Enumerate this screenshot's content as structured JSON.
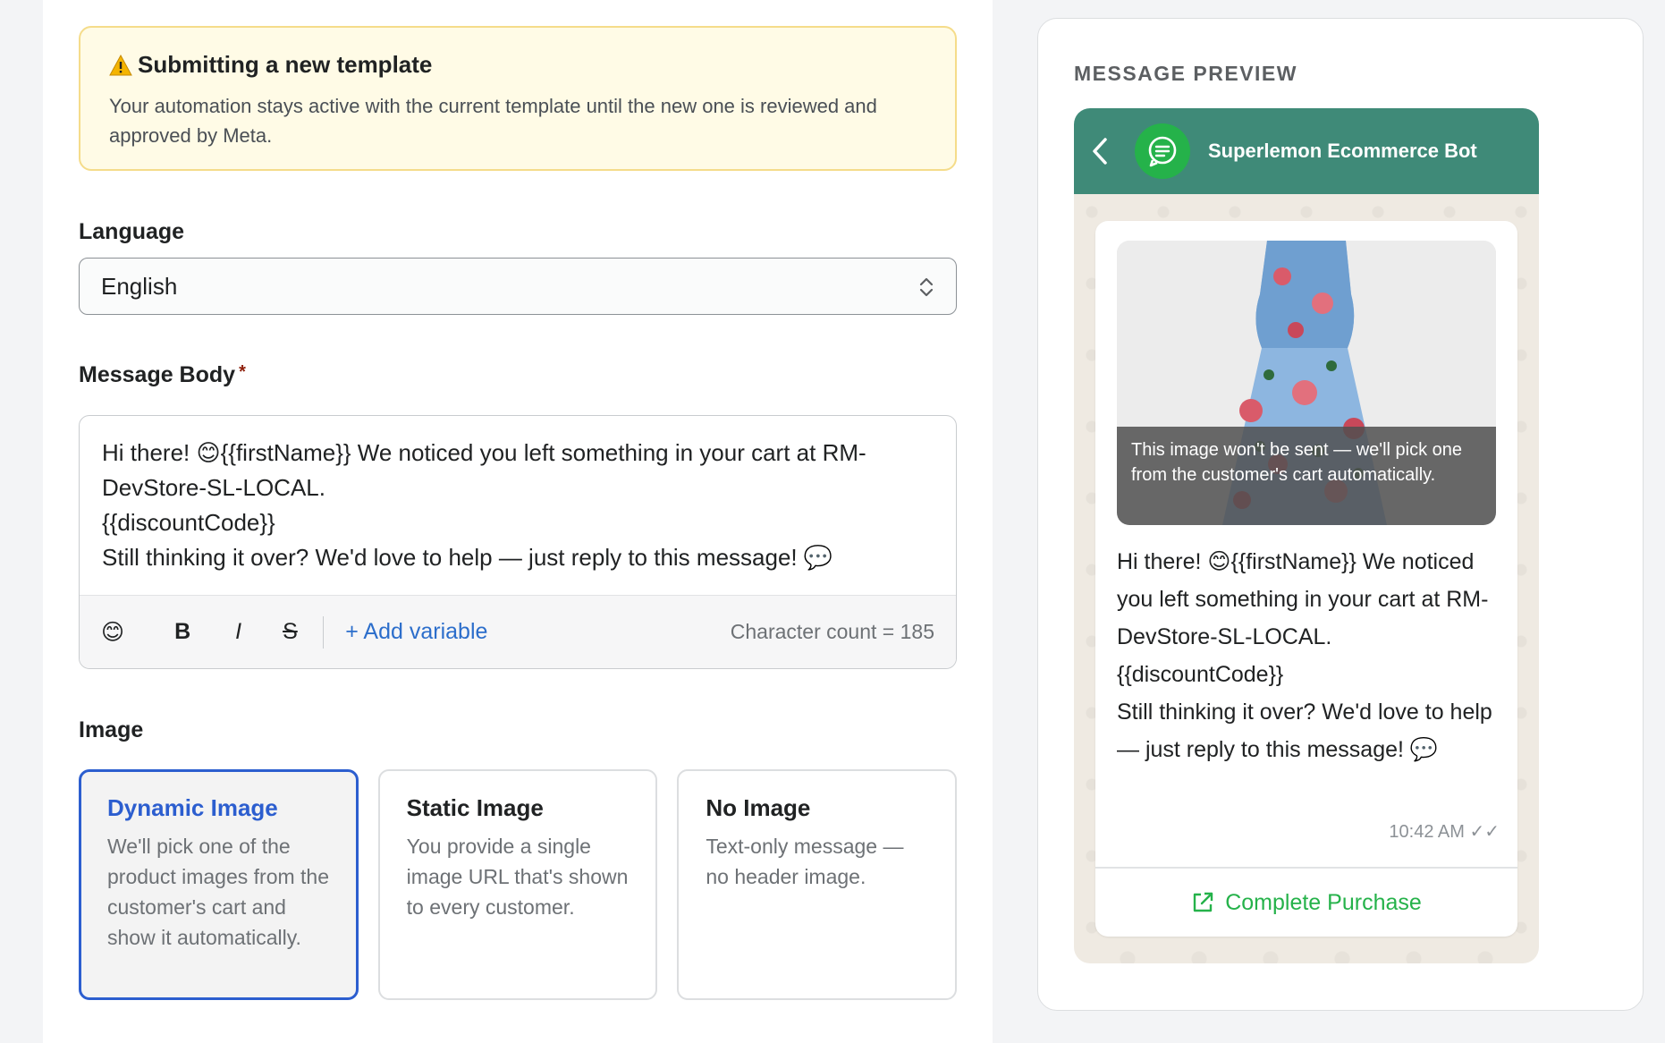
{
  "banner": {
    "title": "Submitting a new template",
    "text": "Your automation stays active with the current template until the new one is reviewed and approved by Meta."
  },
  "language": {
    "label": "Language",
    "value": "English"
  },
  "message_body": {
    "label": "Message Body",
    "required_mark": "*",
    "line1": "Hi there! 😊{{firstName}} We noticed you left something in your cart at RM-DevStore-SL-LOCAL.",
    "line2": "{{discountCode}}",
    "line3": "Still thinking it over? We'd love to help — just reply to this message! 💬",
    "toolbar": {
      "emoji": "😊",
      "bold": "B",
      "italic": "I",
      "strike": "S",
      "add_variable": "+ Add variable",
      "char_count": "Character count = 185"
    }
  },
  "image": {
    "label": "Image",
    "options": [
      {
        "title": "Dynamic Image",
        "desc": "We'll pick one of the product images from the customer's cart and show it automatically."
      },
      {
        "title": "Static Image",
        "desc": "You provide a single image URL that's shown to every customer."
      },
      {
        "title": "No Image",
        "desc": "Text-only message — no header image."
      }
    ]
  },
  "preview": {
    "title": "MESSAGE PREVIEW",
    "bot_name": "Superlemon Ecommerce Bot",
    "image_caption": "This image won't be sent — we'll pick one from the customer's cart automatically.",
    "msg_line1": "Hi there! 😊{{firstName}} We noticed you left something in your cart at RM-DevStore-SL-LOCAL.",
    "msg_line2": "{{discountCode}}",
    "msg_line3": "Still thinking it over? We'd love to help — just reply to this message! 💬",
    "time": "10:42 AM ✓✓",
    "cta": "Complete Purchase"
  },
  "colors": {
    "accent_blue": "#2c5ecf",
    "whatsapp_header": "#3f8a78",
    "whatsapp_green": "#25b24a",
    "banner_bg": "#fffbe6"
  }
}
